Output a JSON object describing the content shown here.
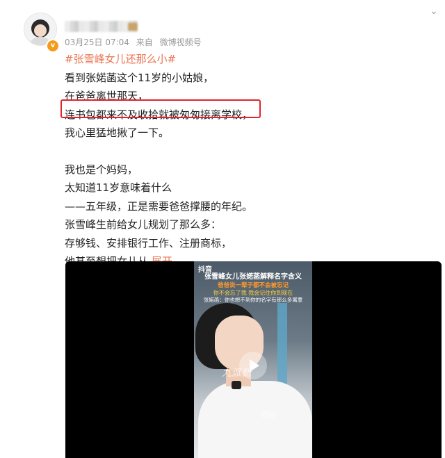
{
  "post": {
    "timestamp": "03月25日 07:04",
    "source_prefix": "来自",
    "source": "微博视频号",
    "topic": "#张雪峰女儿还那么小#",
    "lines": [
      "看到张婼菡这个11岁的小姑娘，",
      "在爸爸离世那天，",
      "连书包都来不及收拾就被匆匆接离学校，",
      "我心里猛地揪了一下。",
      "我也是个妈妈，",
      "太知道11岁意味着什么",
      "——五年级，正是需要爸爸撑腰的年纪。",
      "张雪峰生前给女儿规划了那么多：",
      "存够钱、安排银行工作、注册商标，",
      "他甚至想把女儿从"
    ],
    "expand_label": "展开",
    "expand_icon": "chevron-down-icon"
  },
  "video": {
    "platform_label": "抖音",
    "caption_title": "张雪峰女儿张婼菡解释名字含义",
    "caption_line2": "爸爸说一辈子都不会被忘记",
    "caption_line3": "你不会忘了我 我会记住你到现在",
    "caption_line4": "张婼菡：你也想不到你的名字有那么多寓意",
    "watermark": "九派新",
    "watermark2": "视频"
  },
  "colors": {
    "accent": "#eb7350",
    "highlight_box": "#e0242b",
    "verified": "#f59b1b"
  }
}
